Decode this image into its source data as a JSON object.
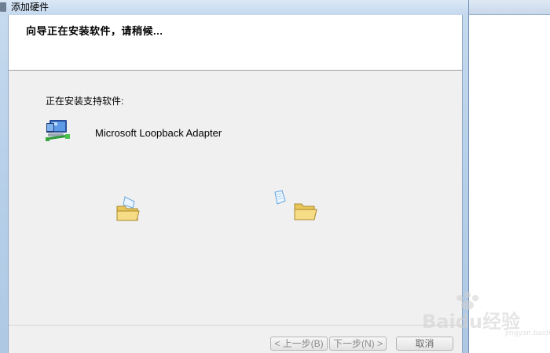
{
  "window": {
    "title": "添加硬件"
  },
  "header": {
    "text": "向导正在安装软件，请稍候..."
  },
  "content": {
    "label": "正在安装支持软件:",
    "device_name": "Microsoft Loopback Adapter"
  },
  "buttons": {
    "back": "< 上一步(B)",
    "next": "下一步(N) >",
    "cancel": "取消"
  },
  "watermark": {
    "brand": "Baidu",
    "brand_cn": "经验",
    "sub": "jingyan.baidu.com"
  },
  "colors": {
    "frame": "#b9d1ea",
    "client": "#f0f0f0",
    "disabled_text": "#8a8a8a"
  }
}
